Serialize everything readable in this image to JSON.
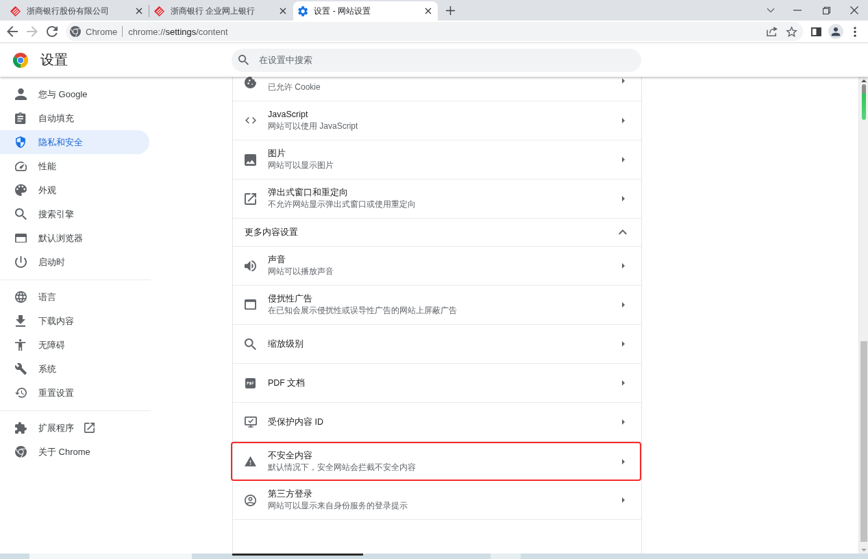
{
  "tabs": [
    {
      "title": "浙商银行股份有限公司",
      "kind": "site",
      "selected": false
    },
    {
      "title": "浙商银行 企业网上银行",
      "kind": "site",
      "selected": false
    },
    {
      "title": "设置 - 网站设置",
      "kind": "settings",
      "selected": true
    }
  ],
  "navigation": {
    "back": {
      "disabled": false
    },
    "forward": {
      "disabled": true
    }
  },
  "omnibox": {
    "chip": "Chrome",
    "url": "chrome://**settings**/content",
    "bookmarked": false
  },
  "header": {
    "title": "设置",
    "search": {
      "placeholder": "在设置中搜索"
    }
  },
  "sidebar": {
    "groups": [
      {
        "items": [
          {
            "label": "您与 Google",
            "selected": false,
            "external": false
          },
          {
            "label": "自动填充",
            "selected": false,
            "external": false
          },
          {
            "label": "隐私和安全",
            "selected": true,
            "external": false
          },
          {
            "label": "性能",
            "selected": false,
            "external": false
          },
          {
            "label": "外观",
            "selected": false,
            "external": false
          },
          {
            "label": "搜索引擎",
            "selected": false,
            "external": false
          },
          {
            "label": "默认浏览器",
            "selected": false,
            "external": false
          },
          {
            "label": "启动时",
            "selected": false,
            "external": false
          }
        ]
      },
      {
        "items": [
          {
            "label": "语言",
            "selected": false,
            "external": false
          },
          {
            "label": "下载内容",
            "selected": false,
            "external": false
          },
          {
            "label": "无障碍",
            "selected": false,
            "external": false
          },
          {
            "label": "系统",
            "selected": false,
            "external": false
          },
          {
            "label": "重置设置",
            "selected": false,
            "external": false
          }
        ]
      },
      {
        "items": [
          {
            "label": "扩展程序",
            "selected": false,
            "external": true
          },
          {
            "label": "关于 Chrome",
            "selected": false,
            "external": false
          }
        ]
      }
    ]
  },
  "content": {
    "rows": [
      {
        "kind": "setting",
        "subtitle": "已允许 Cookie",
        "highlighted": false
      },
      {
        "kind": "setting",
        "title": "JavaScript",
        "subtitle": "网站可以使用 JavaScript",
        "highlighted": false
      },
      {
        "kind": "setting",
        "title": "图片",
        "subtitle": "网站可以显示图片",
        "highlighted": false
      },
      {
        "kind": "setting",
        "title": "弹出式窗口和重定向",
        "subtitle": "不允许网站显示弹出式窗口或使用重定向",
        "highlighted": false
      },
      {
        "kind": "section",
        "title": "更多内容设置",
        "expanded": true
      },
      {
        "kind": "setting",
        "title": "声音",
        "subtitle": "网站可以播放声音",
        "highlighted": false
      },
      {
        "kind": "setting",
        "title": "侵扰性广告",
        "subtitle": "在已知会展示侵扰性或误导性广告的网站上屏蔽广告",
        "highlighted": false
      },
      {
        "kind": "setting",
        "title": "缩放级别",
        "highlighted": false
      },
      {
        "kind": "setting",
        "title": "PDF 文档",
        "highlighted": false
      },
      {
        "kind": "setting",
        "title": "受保护内容 ID",
        "highlighted": false
      },
      {
        "kind": "setting",
        "title": "不安全内容",
        "subtitle": "默认情况下，安全网站会拦截不安全内容",
        "highlighted": true
      },
      {
        "kind": "setting",
        "title": "第三方登录",
        "subtitle": "网站可以显示来自身份服务的登录提示",
        "highlighted": false
      }
    ]
  }
}
